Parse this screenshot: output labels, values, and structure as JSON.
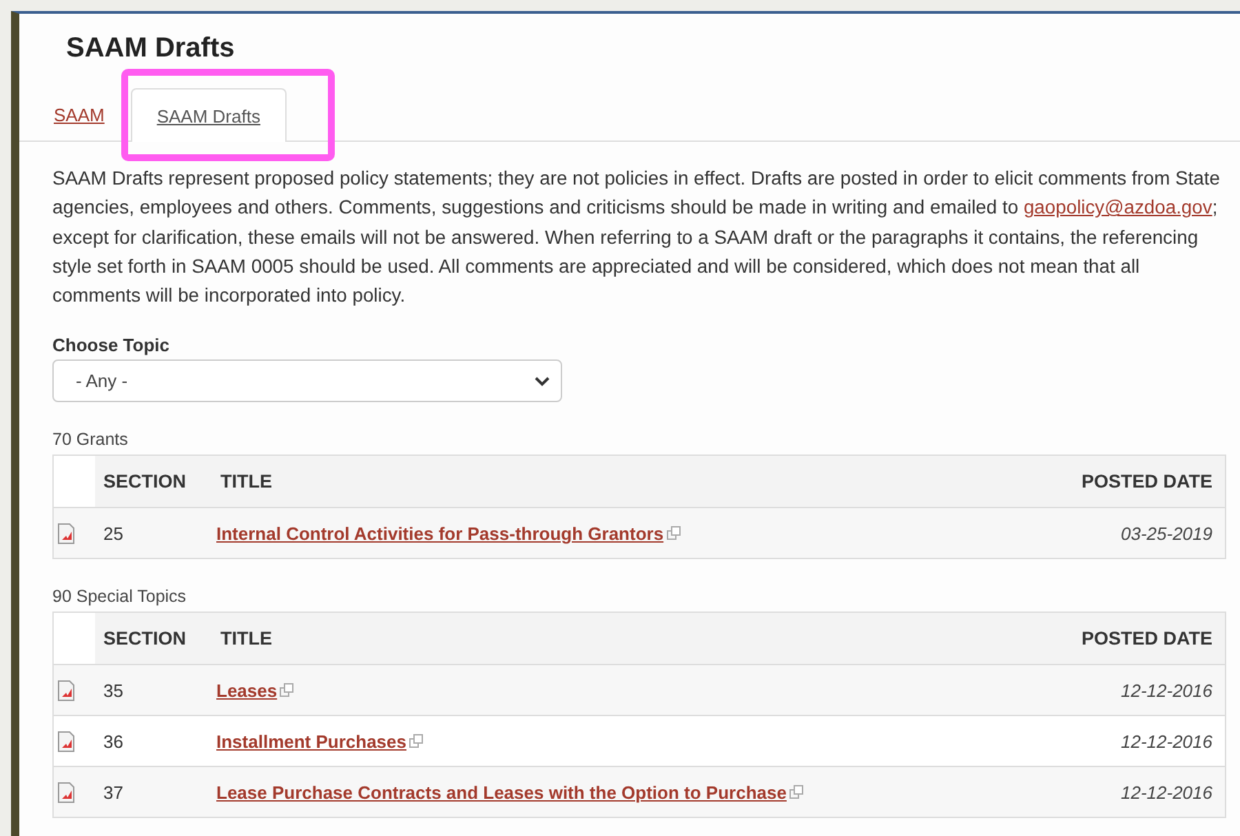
{
  "title": "SAAM Drafts",
  "tabs": [
    {
      "label": "SAAM",
      "selected": false
    },
    {
      "label": "SAAM Drafts",
      "selected": true
    }
  ],
  "intro": {
    "before": "SAAM Drafts represent proposed policy statements; they are not policies in effect. Drafts are posted in order to elicit comments from State agencies, employees and others. Comments, suggestions and criticisms should be made in writing and emailed to ",
    "link": "gaopolicy@azdoa.gov",
    "after": "; except for clarification, these emails will not be answered. When referring to a SAAM draft or the paragraphs it contains, the referencing style set forth in SAAM 0005 should be used. All comments are appreciated and will be considered, which does not mean that all comments will be incorporated into policy."
  },
  "filter": {
    "label": "Choose Topic",
    "value": "- Any -"
  },
  "groups": [
    {
      "heading": "70 Grants",
      "columns": [
        "SECTION",
        "TITLE",
        "POSTED DATE"
      ],
      "rows": [
        {
          "section": "25",
          "title": "Internal Control Activities for Pass-through Grantors",
          "posted_date": "03-25-2019"
        }
      ]
    },
    {
      "heading": "90 Special Topics",
      "columns": [
        "SECTION",
        "TITLE",
        "POSTED DATE"
      ],
      "rows": [
        {
          "section": "35",
          "title": "Leases",
          "posted_date": "12-12-2016"
        },
        {
          "section": "36",
          "title": "Installment Purchases",
          "posted_date": "12-12-2016"
        },
        {
          "section": "37",
          "title": "Lease Purchase Contracts and Leases with the Option to Purchase",
          "posted_date": "12-12-2016"
        }
      ]
    }
  ]
}
